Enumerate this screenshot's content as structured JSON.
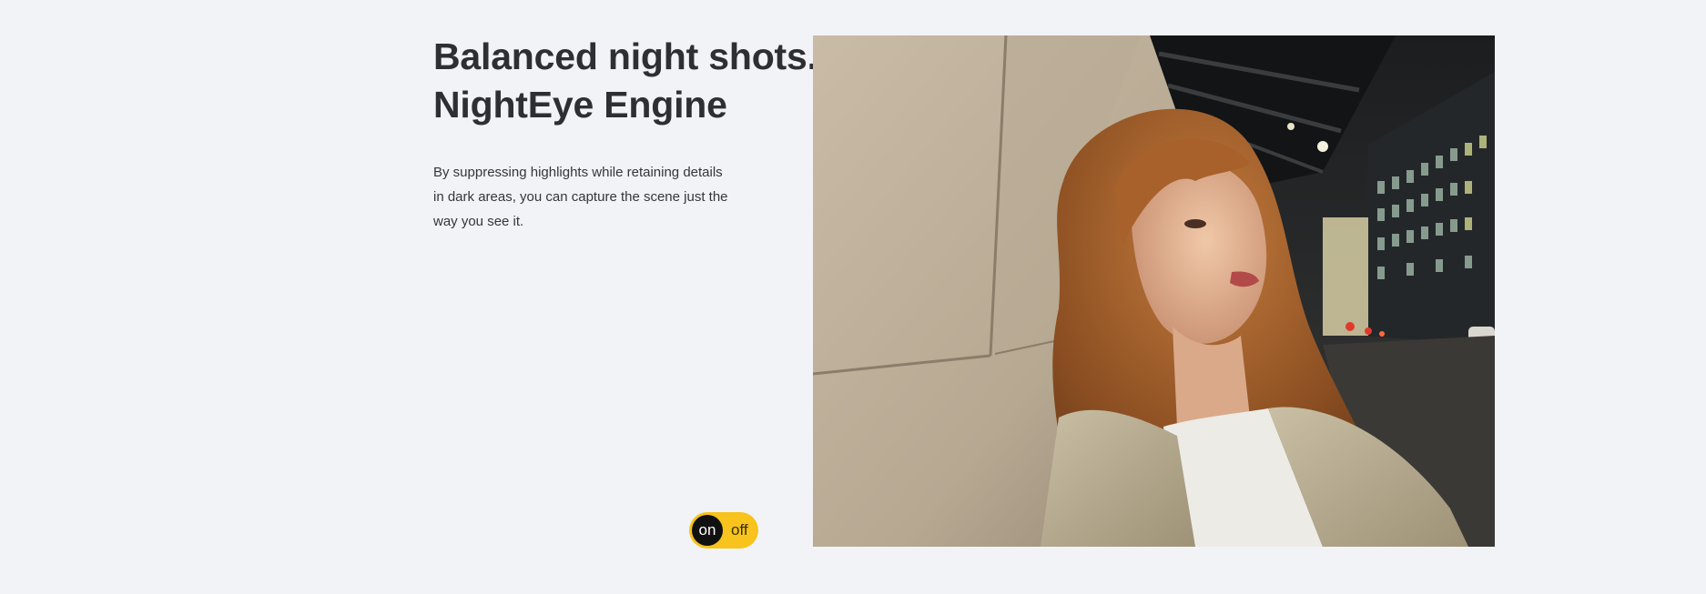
{
  "feature": {
    "headline_line1": "Balanced night shots.",
    "headline_line2": "NightEye Engine",
    "description": "By suppressing highlights while retaining details in dark areas, you can capture the scene just the way you see it."
  },
  "toggle": {
    "on_label": "on",
    "off_label": "off",
    "state": "on"
  },
  "colors": {
    "background": "#f2f3f7",
    "toggle_track": "#f7c31c",
    "toggle_knob": "#111111"
  }
}
